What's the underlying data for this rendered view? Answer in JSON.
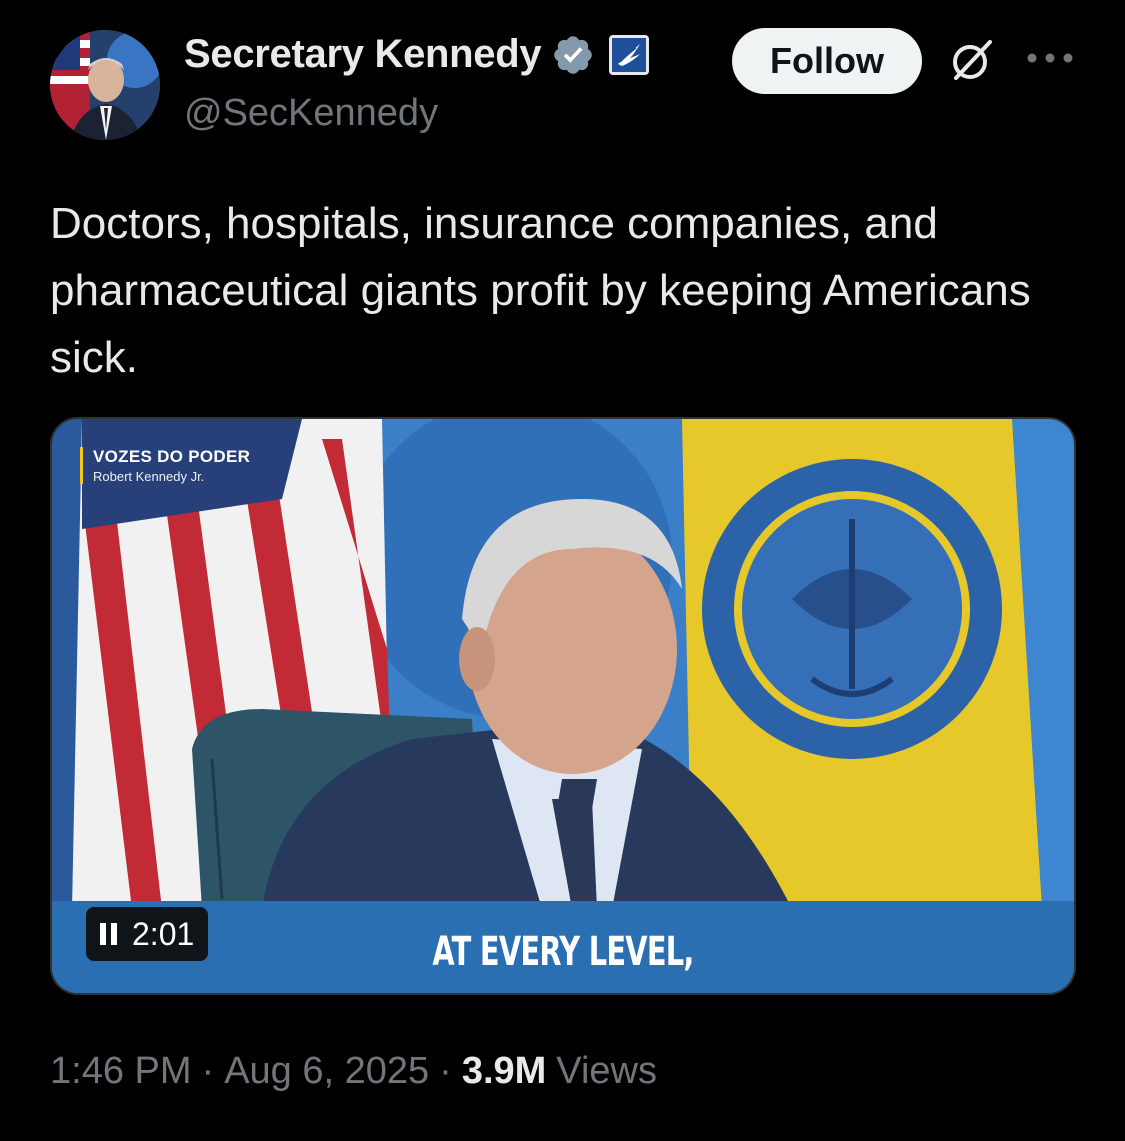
{
  "author": {
    "display_name": "Secretary Kennedy",
    "handle": "@SecKennedy",
    "verified_color": "#829aab",
    "affiliate_badge": "hhs-eagle-icon"
  },
  "actions": {
    "follow_label": "Follow",
    "grok_icon": "grok-icon",
    "more_icon": "more-icon"
  },
  "tweet": {
    "text": "Doctors, hospitals, insurance companies, and pharmaceutical giants profit by keeping Americans sick."
  },
  "media": {
    "overlay_title": "VOZES DO PODER",
    "overlay_subtitle": "Robert Kennedy Jr.",
    "caption": "AT EVERY LEVEL,",
    "time_display": "2:01",
    "playback_state": "playing",
    "caption_bar_color": "#2b6fb3"
  },
  "meta": {
    "time": "1:46 PM",
    "separator1": "·",
    "date": "Aug 6, 2025",
    "separator2": "·",
    "views_count": "3.9M",
    "views_label": "Views"
  }
}
